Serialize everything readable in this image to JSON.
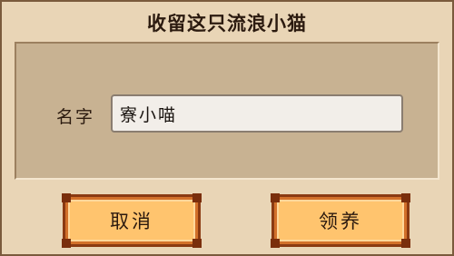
{
  "dialog": {
    "title": "收留这只流浪小猫"
  },
  "form": {
    "name_label": "名字",
    "name_value": "寮小喵"
  },
  "buttons": {
    "cancel_label": "取消",
    "adopt_label": "领养"
  },
  "colors": {
    "background": "#e9d5b6",
    "panel": "#c8b292",
    "button_fill": "#ffc46e",
    "button_border": "#8a3a12"
  }
}
